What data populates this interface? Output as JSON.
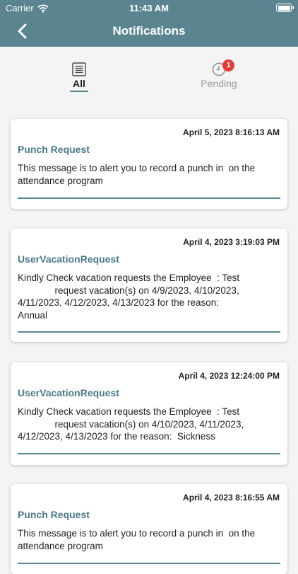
{
  "status_bar": {
    "carrier": "Carrier",
    "time": "11:43 AM"
  },
  "header": {
    "title": "Notifications"
  },
  "tabs": {
    "all": {
      "label": "All",
      "icon": "list-icon"
    },
    "pending": {
      "label": "Pending",
      "icon": "clock-icon",
      "badge": "1"
    }
  },
  "notifications": [
    {
      "time": "April 5, 2023 8:16:13 AM",
      "title": "Punch Request",
      "message": "This message is to alert you to record a punch in  on the attendance program"
    },
    {
      "time": "April 4, 2023 3:19:03 PM",
      "title": "UserVacationRequest",
      "message": "Kindly Check vacation requests the Employee  : Test\n              request vacation(s) on 4/9/2023, 4/10/2023,\n4/11/2023, 4/12/2023, 4/13/2023 for the reason:\nAnnual"
    },
    {
      "time": "April 4, 2023 12:24:00 PM",
      "title": "UserVacationRequest",
      "message": "Kindly Check vacation requests the Employee  : Test\n              request vacation(s) on 4/10/2023, 4/11/2023,\n4/12/2023, 4/13/2023 for the reason:  Sickness"
    },
    {
      "time": "April 4, 2023 8:16:55 AM",
      "title": "Punch Request",
      "message": "This message is to alert you to record a punch in  on the attendance program"
    }
  ],
  "colors": {
    "header": "#5a8590",
    "accent": "#4a7a88",
    "badge": "#e53935"
  }
}
